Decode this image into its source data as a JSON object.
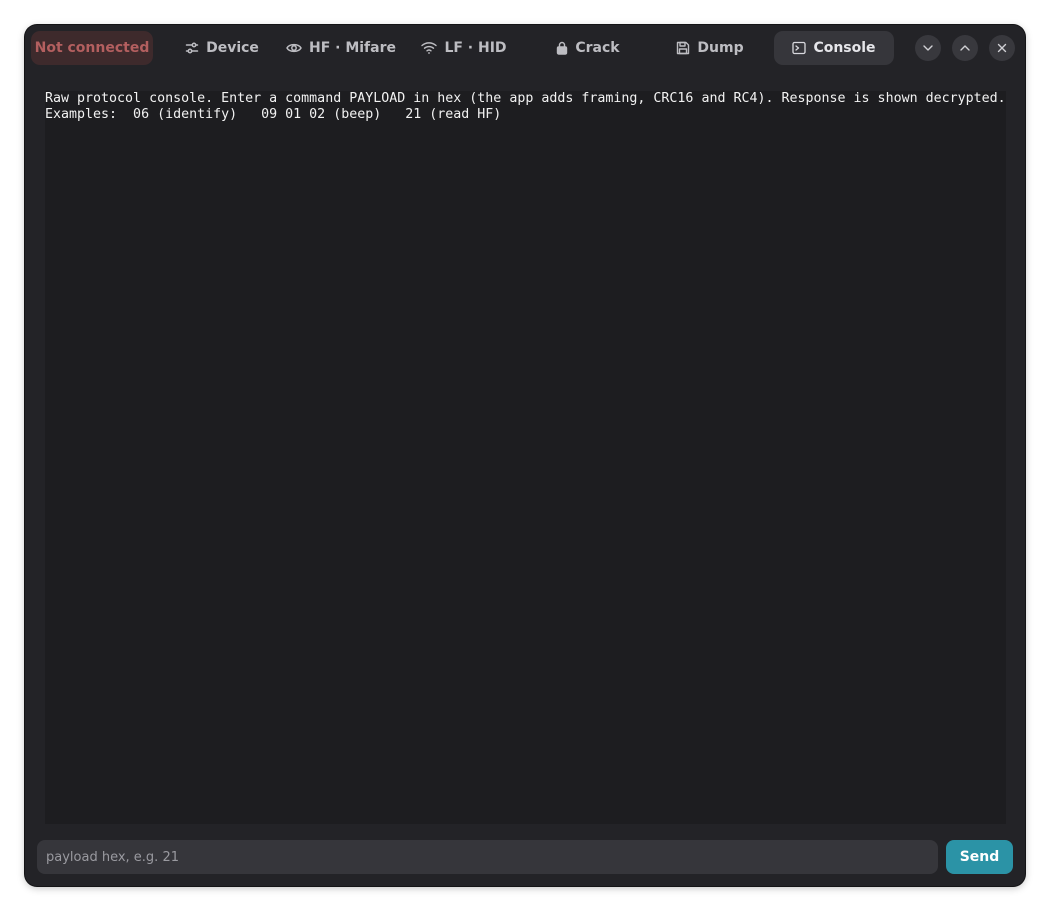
{
  "header": {
    "status": "Not connected",
    "tabs": [
      {
        "label": "Device",
        "icon": "sliders-icon",
        "active": false
      },
      {
        "label": "HF · Mifare",
        "icon": "eye-icon",
        "active": false
      },
      {
        "label": "LF · HID",
        "icon": "wifi-icon",
        "active": false
      },
      {
        "label": "Crack",
        "icon": "lock-icon",
        "active": false
      },
      {
        "label": "Dump",
        "icon": "save-icon",
        "active": false
      },
      {
        "label": "Console",
        "icon": "terminal-icon",
        "active": true
      }
    ],
    "window_controls": [
      "chevron-down-icon",
      "chevron-up-icon",
      "close-icon"
    ]
  },
  "console": {
    "intro": "Raw protocol console. Enter a command PAYLOAD in hex (the app adds framing, CRC16 and RC4). Response is shown decrypted.",
    "examples": "Examples:  06 (identify)   09 01 02 (beep)   21 (read HF)"
  },
  "input": {
    "placeholder": "payload hex, e.g. 21",
    "value": ""
  },
  "send_label": "Send",
  "colors": {
    "window_bg": "#232327",
    "console_bg": "#1d1d20",
    "active_tab_bg": "#36363b",
    "status_bg": "#3e2a2c",
    "status_text": "#b35f5f",
    "accent": "#2b93a6"
  }
}
